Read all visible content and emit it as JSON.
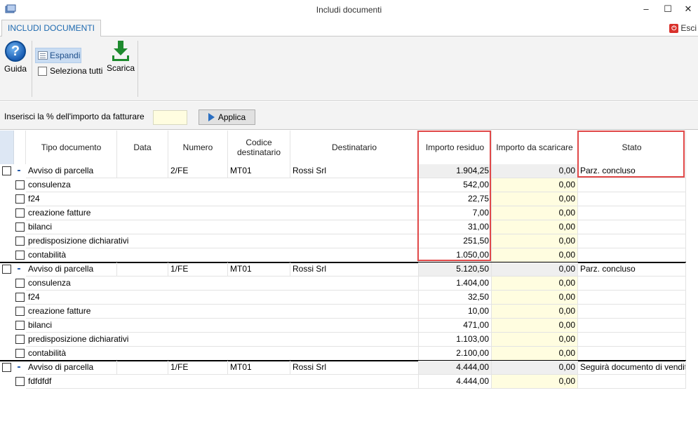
{
  "window": {
    "title": "Includi documenti",
    "minimize_glyph": "–",
    "maximize_glyph": "☐",
    "close_glyph": "✕"
  },
  "tabs": [
    {
      "label": "INCLUDI DOCUMENTI",
      "active": true
    }
  ],
  "exit_label": "Esci",
  "ribbon": {
    "help_label": "Guida",
    "expand_label": "Espandi",
    "select_all_label": "Seleziona tutti",
    "download_label": "Scarica"
  },
  "filter": {
    "label": "Inserisci la % dell'importo da fatturare",
    "value": "",
    "apply_label": "Applica"
  },
  "columns": {
    "tipo": "Tipo documento",
    "data": "Data",
    "numero": "Numero",
    "codice": "Codice destinatario",
    "destinatario": "Destinatario",
    "residuo": "Importo residuo",
    "scaricare": "Importo da scaricare",
    "stato": "Stato"
  },
  "groups": [
    {
      "tipo": "Avviso di parcella",
      "data": "",
      "numero": "2/FE",
      "codice": "MT01",
      "destinatario": "Rossi Srl",
      "residuo": "1.904,25",
      "scaricare": "0,00",
      "stato": "Parz. concluso",
      "items": [
        {
          "tipo": "consulenza",
          "residuo": "542,00",
          "scaricare": "0,00"
        },
        {
          "tipo": "f24",
          "residuo": "22,75",
          "scaricare": "0,00"
        },
        {
          "tipo": "creazione fatture",
          "residuo": "7,00",
          "scaricare": "0,00"
        },
        {
          "tipo": "bilanci",
          "residuo": "31,00",
          "scaricare": "0,00"
        },
        {
          "tipo": "predisposizione dichiarativi",
          "residuo": "251,50",
          "scaricare": "0,00"
        },
        {
          "tipo": "contabilità",
          "residuo": "1.050,00",
          "scaricare": "0,00"
        }
      ]
    },
    {
      "tipo": "Avviso di parcella",
      "data": "",
      "numero": "1/FE",
      "codice": "MT01",
      "destinatario": "Rossi Srl",
      "residuo": "5.120,50",
      "scaricare": "0,00",
      "stato": "Parz. concluso",
      "items": [
        {
          "tipo": "consulenza",
          "residuo": "1.404,00",
          "scaricare": "0,00"
        },
        {
          "tipo": "f24",
          "residuo": "32,50",
          "scaricare": "0,00"
        },
        {
          "tipo": "creazione fatture",
          "residuo": "10,00",
          "scaricare": "0,00"
        },
        {
          "tipo": "bilanci",
          "residuo": "471,00",
          "scaricare": "0,00"
        },
        {
          "tipo": "predisposizione dichiarativi",
          "residuo": "1.103,00",
          "scaricare": "0,00"
        },
        {
          "tipo": "contabilità",
          "residuo": "2.100,00",
          "scaricare": "0,00"
        }
      ]
    },
    {
      "tipo": "Avviso di parcella",
      "data": "",
      "numero": "1/FE",
      "codice": "MT01",
      "destinatario": "Rossi Srl",
      "residuo": "4.444,00",
      "scaricare": "0,00",
      "stato": "Seguirà documento di vendit",
      "items": [
        {
          "tipo": "fdfdfdf",
          "residuo": "4.444,00",
          "scaricare": "0,00"
        }
      ]
    }
  ],
  "colors": {
    "accent": "#1e6ab0",
    "highlight_box": "#e04848",
    "editable_cell": "#fffde0"
  }
}
